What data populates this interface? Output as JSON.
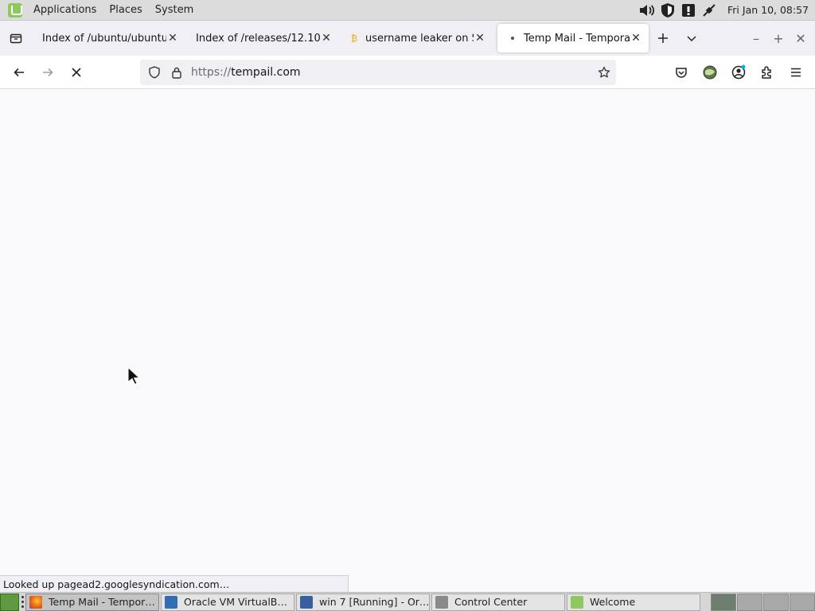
{
  "top_panel": {
    "menus": [
      "Applications",
      "Places",
      "System"
    ],
    "clock": "Fri Jan 10, 08:57"
  },
  "browser": {
    "tabs": [
      {
        "title": "Index of /ubuntu/ubuntu/",
        "active": false,
        "icon": "none"
      },
      {
        "title": "Index of /releases/12.10",
        "active": false,
        "icon": "none"
      },
      {
        "title": "username leaker on Sc",
        "active": false,
        "icon": "bitcoin-icon"
      },
      {
        "title": "Temp Mail - Temporary",
        "active": true,
        "icon": "loading-dot-icon"
      }
    ],
    "url": {
      "scheme": "https://",
      "host": "tempail.com"
    },
    "status_text": "Looked up pagead2.googlesyndication.com…"
  },
  "taskbar": {
    "tasks": [
      {
        "label": "Temp Mail - Tempor…",
        "active": true,
        "icon": "firefox-icon",
        "color": "#e66000"
      },
      {
        "label": "Oracle VM VirtualB…",
        "active": false,
        "icon": "virtualbox-icon",
        "color": "#2f6db5"
      },
      {
        "label": "win 7 [Running] - Or…",
        "active": false,
        "icon": "virtualbox-vm-icon",
        "color": "#3a5f9e"
      },
      {
        "label": "Control Center",
        "active": false,
        "icon": "control-center-icon",
        "color": "#888888"
      },
      {
        "label": "Welcome",
        "active": false,
        "icon": "mint-welcome-icon",
        "color": "#8fc85f"
      }
    ]
  },
  "colors": {
    "accent": "#0061e0",
    "mint": "#8fc85f"
  }
}
